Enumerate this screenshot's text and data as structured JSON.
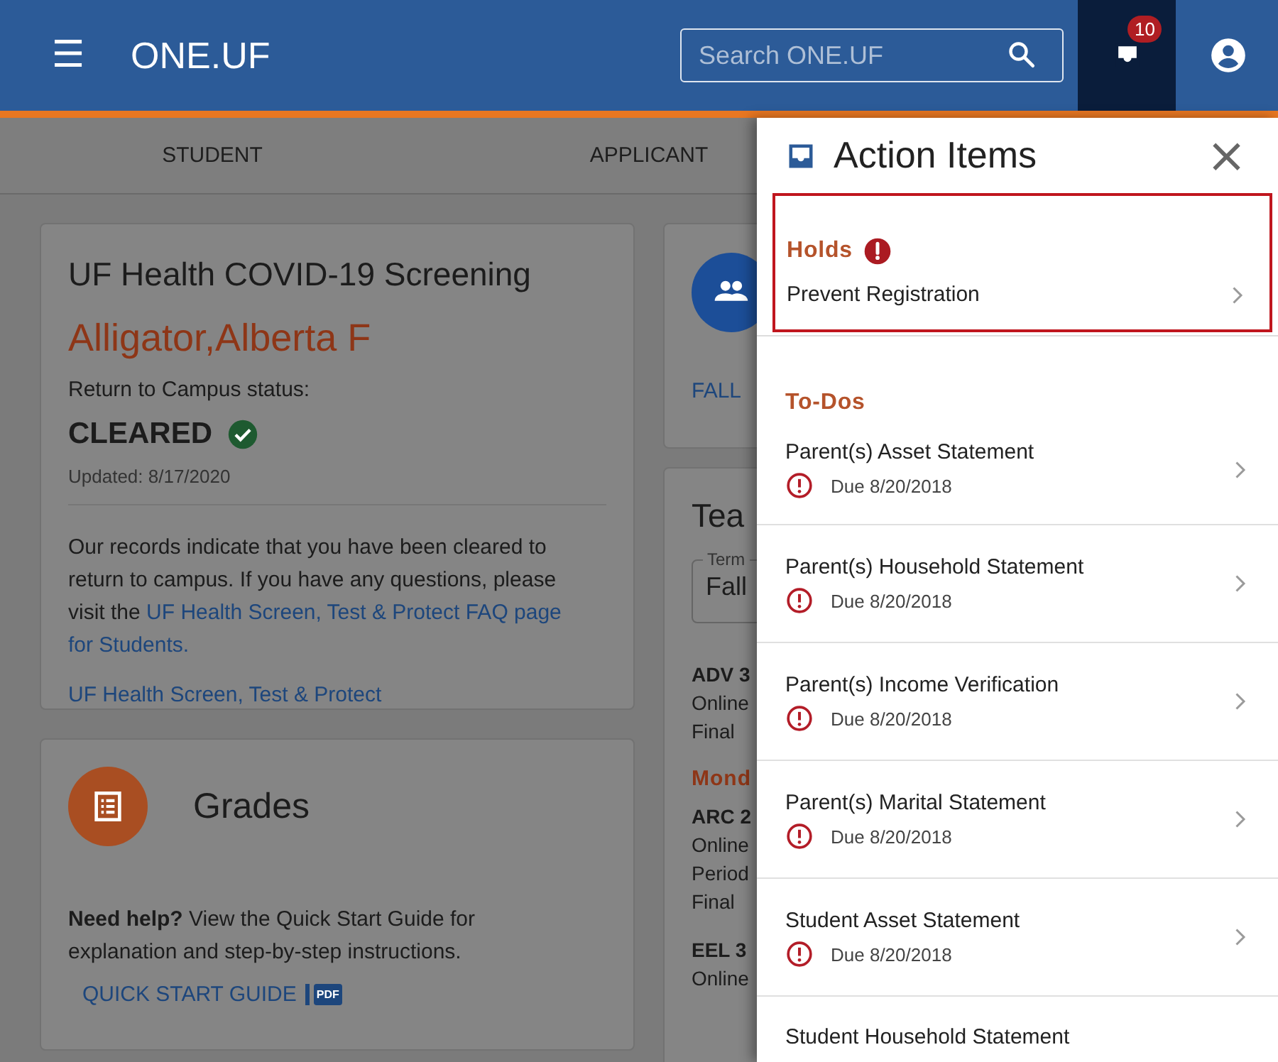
{
  "header": {
    "menu_icon": "☰",
    "title": "ONE.UF",
    "search": {
      "placeholder": "Search ONE.UF"
    },
    "inbox_badge": "10"
  },
  "tabs": [
    {
      "label": "STUDENT"
    },
    {
      "label": "APPLICANT"
    }
  ],
  "covid_card": {
    "title": "UF Health COVID-19 Screening",
    "name": "Alligator,Alberta F",
    "status_label": "Return to Campus status:",
    "status": "CLEARED",
    "updated": "Updated: 8/17/2020",
    "message": "Our records indicate that you have been cleared to return to campus. If you have any questions, please visit the",
    "message_link_lines": [
      "UF Health Screen, Test & Protect FAQ page",
      "for Students."
    ],
    "link": "UF Health Screen, Test & Protect"
  },
  "grades_card": {
    "title": "Grades",
    "help": "**Need help?** View the Quick Start Guide for explanation and step-by-step instructions.",
    "guide_link": "QUICK START GUIDE",
    "guide_badge": "PDF"
  },
  "middle_column": {
    "term_link": "FALL",
    "schedule_title": "Tea",
    "term_field": {
      "label": "Term",
      "value": "Fall"
    },
    "lines": [
      {
        "kind": "course",
        "text": "ADV 3"
      },
      {
        "kind": "detail",
        "text": "Online"
      },
      {
        "kind": "detail",
        "text": "Final"
      },
      {
        "kind": "day",
        "text": "Mond"
      },
      {
        "kind": "course",
        "text": "ARC 2"
      },
      {
        "kind": "detail",
        "text": "Online"
      },
      {
        "kind": "detail",
        "text": "Period"
      },
      {
        "kind": "detail",
        "text": "Final"
      },
      {
        "kind": "course",
        "text": "EEL 3"
      },
      {
        "kind": "detail",
        "text": "Online"
      }
    ]
  },
  "action_items": {
    "title": "Action Items",
    "close": "×",
    "holds": {
      "heading": "Holds",
      "items": [
        {
          "title": "Prevent Registration"
        }
      ]
    },
    "todos": {
      "heading": "To-Dos",
      "items": [
        {
          "title": "Parent(s) Asset Statement",
          "due": "Due 8/20/2018"
        },
        {
          "title": "Parent(s) Household Statement",
          "due": "Due 8/20/2018"
        },
        {
          "title": "Parent(s) Income Verification",
          "due": "Due 8/20/2018"
        },
        {
          "title": "Parent(s) Marital Statement",
          "due": "Due 8/20/2018"
        },
        {
          "title": "Student Asset Statement",
          "due": "Due 8/20/2018"
        },
        {
          "title": "Student Household Statement"
        }
      ]
    }
  }
}
